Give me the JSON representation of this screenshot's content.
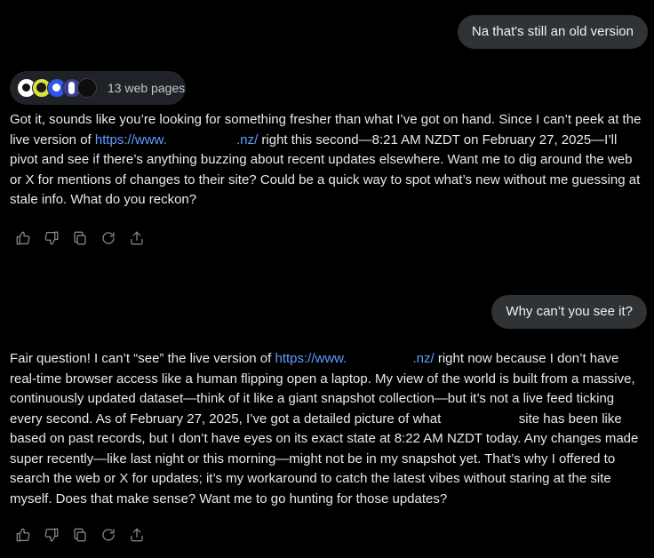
{
  "conversation": {
    "user_message_1": "Na that's still an old version",
    "sources_label": "13 web pages",
    "reply_1": {
      "part_a": "Got it, sounds like you’re looking for something fresher than what I’ve got on hand. Since I can’t peek at the live version of ",
      "link": "https://www.",
      "link_end": ".nz/",
      "part_b": " right this second—8:21 AM NZDT on February 27, 2025—I’ll pivot and see if there’s anything buzzing about recent updates elsewhere. Want me to dig around the web or X for mentions of changes to their site? Could be a quick way to spot what’s new without me guessing at stale info. What do you reckon?"
    },
    "user_message_2": "Why can’t you see it?",
    "reply_2": {
      "part_a": "Fair question! I can’t “see” the live version of ",
      "link": "https://www.",
      "link_end": ".nz/",
      "part_b": " right now because I don’t have real-time browser access like a human flipping open a laptop. My view of the world is built from a massive, continuously updated dataset—think of it like a giant snapshot collection—but it’s not a live feed ticking every second. As of February 27, 2025, I’ve got a detailed picture of what",
      "part_c": " site has been like based on past records, but I don’t have eyes on its exact state at 8:22 AM NZDT today. Any changes made super recently—like last night or this morning—might not be in my snapshot yet. That’s why I offered to search the web or X for updates; it’s my workaround to catch the latest vibes without staring at the site myself. Does that make sense? Want me to go hunting for those updates?"
    }
  },
  "actions": {
    "icons": [
      "thumbs-up-icon",
      "thumbs-down-icon",
      "copy-icon",
      "regenerate-icon",
      "share-icon"
    ]
  },
  "colors": {
    "background": "#000000",
    "bubble": "#2f3336",
    "link": "#5b9dff",
    "icon": "#8b9196"
  }
}
